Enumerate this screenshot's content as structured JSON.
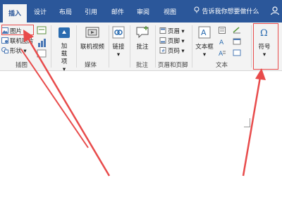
{
  "tabs": [
    "插入",
    "设计",
    "布局",
    "引用",
    "邮件",
    "审阅",
    "视图"
  ],
  "search": {
    "placeholder": "告诉我你想要做什么"
  },
  "illustrations": {
    "items": [
      "图片",
      "联机图片",
      "形状"
    ],
    "label": "插图"
  },
  "addins": {
    "label": "加载项"
  },
  "media": {
    "button": "联机视频",
    "label": "媒体"
  },
  "links": {
    "button": "链接"
  },
  "comments": {
    "button": "批注",
    "label": "批注"
  },
  "header_footer": {
    "items": [
      "页眉",
      "页脚",
      "页码"
    ],
    "label": "页眉和页脚"
  },
  "text": {
    "textbox": "文本框",
    "label": "文本"
  },
  "symbols": {
    "button": "符号"
  },
  "colors": {
    "accent": "#2b579a",
    "annotation": "#e84b4b",
    "ribbon_bg": "#f3f3f3"
  },
  "icons": [
    "picture-icon",
    "online-picture-icon",
    "shapes-icon",
    "store-icon",
    "video-icon",
    "link-icon",
    "comment-icon",
    "header-icon",
    "footer-icon",
    "page-number-icon",
    "textbox-icon",
    "omega-icon",
    "search-icon",
    "user-icon"
  ]
}
